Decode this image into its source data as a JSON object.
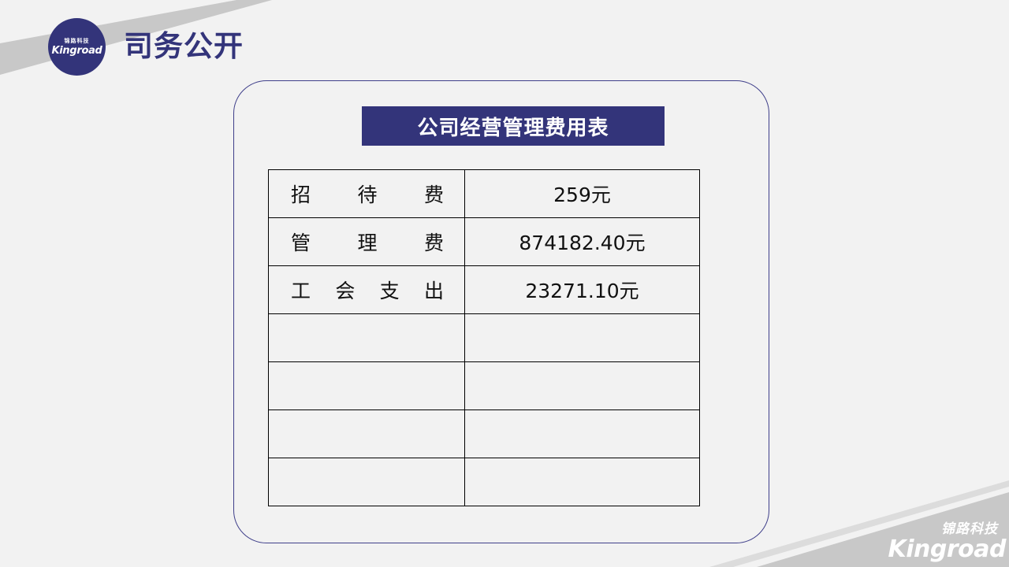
{
  "header": {
    "logo_cn": "锦路科技",
    "logo_en": "Kingroad",
    "title": "司务公开"
  },
  "table": {
    "title": "公司经营管理费用表",
    "rows": [
      {
        "label": [
          "招",
          "待",
          "费"
        ],
        "value": "259元"
      },
      {
        "label": [
          "管",
          "理",
          "费"
        ],
        "value": "874182.40元"
      },
      {
        "label": [
          "工",
          "会",
          "支",
          "出"
        ],
        "value": "23271.10元"
      },
      {
        "label": [],
        "value": ""
      },
      {
        "label": [],
        "value": ""
      },
      {
        "label": [],
        "value": ""
      },
      {
        "label": [],
        "value": ""
      }
    ]
  },
  "footer_logo": {
    "cn": "锦路科技",
    "en": "Kingroad"
  },
  "colors": {
    "brand": "#33347a",
    "background": "#f2f2f2",
    "stripe": "#c8c8c8"
  }
}
